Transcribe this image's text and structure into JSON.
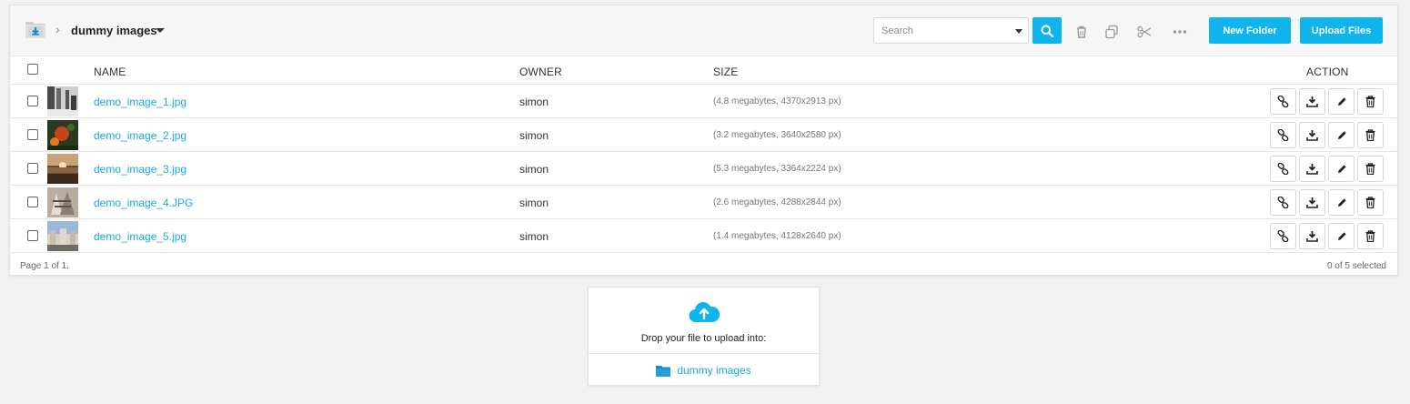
{
  "breadcrumb": {
    "title": "dummy images",
    "folder_icon": "folder-download-icon"
  },
  "search": {
    "placeholder": "Search"
  },
  "toolbar": {
    "new_folder": "New Folder",
    "upload_files": "Upload Files"
  },
  "table": {
    "headers": {
      "name": "NAME",
      "owner": "OWNER",
      "size": "SIZE",
      "action": "ACTION"
    },
    "rows": [
      {
        "name": "demo_image_1.jpg",
        "owner": "simon",
        "size": "(4.8 megabytes, 4370x2913 px)"
      },
      {
        "name": "demo_image_2.jpg",
        "owner": "simon",
        "size": "(3.2 megabytes, 3640x2580 px)"
      },
      {
        "name": "demo_image_3.jpg",
        "owner": "simon",
        "size": "(5.3 megabytes, 3364x2224 px)"
      },
      {
        "name": "demo_image_4.JPG",
        "owner": "simon",
        "size": "(2.6 megabytes, 4288x2844 px)"
      },
      {
        "name": "demo_image_5.jpg",
        "owner": "simon",
        "size": "(1.4 megabytes, 4128x2640 px)"
      }
    ]
  },
  "footer": {
    "page": "Page 1 of 1.",
    "selected": "0 of 5 selected"
  },
  "dropzone": {
    "text": "Drop your file to upload into:",
    "target": "dummy images"
  },
  "colors": {
    "accent": "#0fb4ec",
    "link": "#1aa9e0"
  }
}
